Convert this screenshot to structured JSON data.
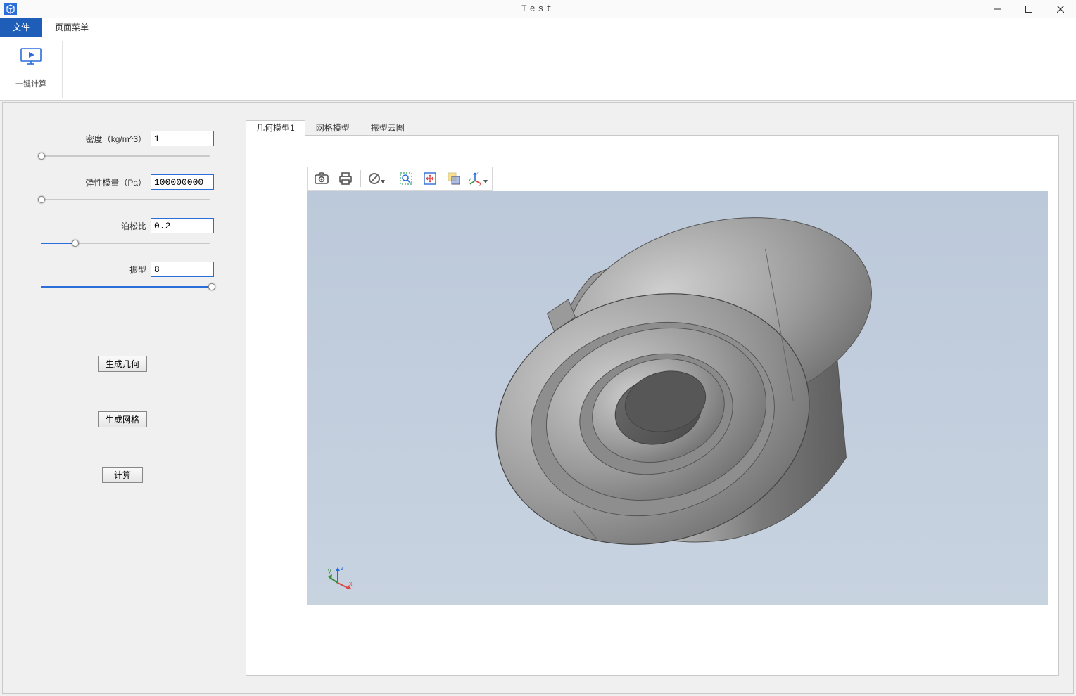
{
  "window": {
    "title": "Test"
  },
  "menuTabs": {
    "file": "文件",
    "pageMenu": "页面菜单"
  },
  "ribbon": {
    "oneClickCalc": "一键计算"
  },
  "params": {
    "density": {
      "label": "密度（kg/m^3）",
      "value": "1",
      "slider_pct": 0
    },
    "youngs": {
      "label": "弹性模量（Pa）",
      "value": "100000000",
      "slider_pct": 0
    },
    "poisson": {
      "label": "泊松比",
      "value": "0.2",
      "slider_pct": 20
    },
    "mode": {
      "label": "振型",
      "value": "8",
      "slider_pct": 100
    }
  },
  "actions": {
    "genGeom": "生成几何",
    "genMesh": "生成网格",
    "compute": "计算"
  },
  "viewerTabs": {
    "geom1": "几何模型1",
    "mesh": "网格模型",
    "modeCloud": "振型云图"
  },
  "viewerTools": {
    "snapshot": "snapshot-icon",
    "print": "print-icon",
    "reset": "reset-view-icon",
    "zoomWindow": "zoom-window-icon",
    "zoomExtents": "zoom-extents-icon",
    "transparency": "transparency-icon",
    "axes": "axes-menu-icon"
  }
}
